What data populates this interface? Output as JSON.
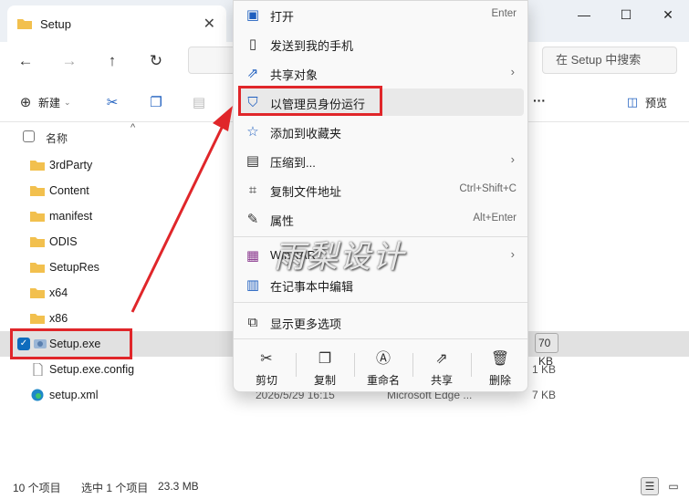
{
  "window": {
    "tab_title": "Setup",
    "tab_close": "✕",
    "controls": {
      "minimize": "—",
      "maximize": "☐",
      "close": "✕"
    }
  },
  "addressbar": {
    "back": "←",
    "forward": "→",
    "up": "↑",
    "refresh": "↻",
    "search_placeholder": "在 Setup 中搜索"
  },
  "commandbar": {
    "new_label": "新建",
    "preview_label": "预览",
    "more": "···"
  },
  "filelist": {
    "column_name": "名称",
    "sort_indicator": "^",
    "files": [
      {
        "name": "3rdParty",
        "type": "folder"
      },
      {
        "name": "Content",
        "type": "folder"
      },
      {
        "name": "manifest",
        "type": "folder"
      },
      {
        "name": "ODIS",
        "type": "folder"
      },
      {
        "name": "SetupRes",
        "type": "folder"
      },
      {
        "name": "x64",
        "type": "folder"
      },
      {
        "name": "x86",
        "type": "folder"
      },
      {
        "name": "Setup.exe",
        "type": "exe",
        "size": "70 KB",
        "selected": true
      },
      {
        "name": "Setup.exe.config",
        "type": "config",
        "size": "1 KB"
      },
      {
        "name": "setup.xml",
        "type": "xml",
        "date": "2026/5/29 16:15",
        "filetype": "Microsoft Edge ...",
        "size": "7 KB"
      }
    ]
  },
  "statusbar": {
    "item_count": "10 个项目",
    "selected": "选中 1 个项目",
    "size": "23.3 MB"
  },
  "context_menu": {
    "items": [
      {
        "label": "打开",
        "shortcut": "Enter",
        "icon": "open-icon"
      },
      {
        "label": "发送到我的手机",
        "icon": "phone-icon"
      },
      {
        "label": "共享对象",
        "icon": "share-icon",
        "submenu": true
      },
      {
        "label": "以管理员身份运行",
        "icon": "shield-icon",
        "highlighted": true
      },
      {
        "label": "添加到收藏夹",
        "icon": "star-icon"
      },
      {
        "label": "压缩到...",
        "icon": "zip-icon",
        "submenu": true
      },
      {
        "label": "复制文件地址",
        "shortcut": "Ctrl+Shift+C",
        "icon": "copy-path-icon"
      },
      {
        "label": "属性",
        "shortcut": "Alt+Enter",
        "icon": "wrench-icon"
      },
      {
        "label": "WinRAR",
        "icon": "winrar-icon",
        "submenu": true
      },
      {
        "label": "在记事本中编辑",
        "icon": "notepad-icon"
      },
      {
        "label": "显示更多选项",
        "icon": "more-options-icon"
      }
    ],
    "bottom_actions": [
      {
        "label": "剪切",
        "icon": "scissors-icon"
      },
      {
        "label": "复制",
        "icon": "copy-icon"
      },
      {
        "label": "重命名",
        "icon": "rename-icon"
      },
      {
        "label": "共享",
        "icon": "share-icon"
      },
      {
        "label": "删除",
        "icon": "trash-icon"
      }
    ]
  },
  "watermark": "雨梨设计",
  "colors": {
    "accent": "#0f6cbd",
    "highlight_red": "#e0262a",
    "folder": "#f2c04e"
  }
}
